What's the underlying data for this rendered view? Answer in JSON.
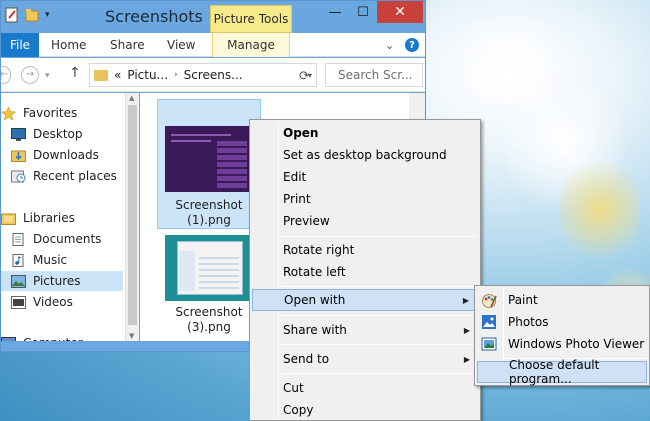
{
  "window": {
    "title": "Screenshots",
    "contextual_tab": "Picture Tools",
    "controls": {
      "minimize": "—",
      "maximize": "☐",
      "close": "✕"
    }
  },
  "ribbon": {
    "tabs": [
      "File",
      "Home",
      "Share",
      "View",
      "Manage"
    ],
    "expand_glyph": "⌄",
    "help_glyph": "?"
  },
  "address": {
    "back_glyph": "←",
    "forward_glyph": "→",
    "up_glyph": "↑",
    "dropdown_glyph": "▾",
    "prefix": "«",
    "segments": [
      "Pictu...",
      "Screens..."
    ],
    "separator": "›",
    "refresh_glyph": "⟳",
    "search_placeholder": "Search Scr..."
  },
  "nav_pane": {
    "items": [
      {
        "label": "Favorites",
        "icon": "star-icon"
      },
      {
        "label": "Desktop",
        "icon": "desktop-icon"
      },
      {
        "label": "Downloads",
        "icon": "downloads-icon"
      },
      {
        "label": "Recent places",
        "icon": "recent-places-icon"
      },
      {
        "label": "Libraries",
        "icon": "libraries-icon"
      },
      {
        "label": "Documents",
        "icon": "documents-icon"
      },
      {
        "label": "Music",
        "icon": "music-icon"
      },
      {
        "label": "Pictures",
        "icon": "pictures-icon",
        "selected": true
      },
      {
        "label": "Videos",
        "icon": "videos-icon"
      },
      {
        "label": "Computer",
        "icon": "computer-icon"
      }
    ]
  },
  "files": [
    {
      "name_line1": "Screenshot",
      "name_line2": "(1).png",
      "selected": true
    },
    {
      "name_line1": "Screenshot",
      "name_line2": "(3).png",
      "selected": false
    }
  ],
  "context_menu": {
    "items": [
      {
        "label": "Open",
        "bold": true
      },
      {
        "label": "Set as desktop background"
      },
      {
        "label": "Edit"
      },
      {
        "label": "Print"
      },
      {
        "label": "Preview"
      },
      {
        "label": "Rotate right"
      },
      {
        "label": "Rotate left"
      },
      {
        "label": "Open with",
        "submenu": true,
        "highlighted": true
      },
      {
        "label": "Share with",
        "submenu": true
      },
      {
        "label": "Send to",
        "submenu": true
      },
      {
        "label": "Cut"
      },
      {
        "label": "Copy"
      }
    ],
    "submenu_arrow": "▶"
  },
  "open_with_menu": {
    "items": [
      {
        "label": "Paint",
        "icon": "paint-icon"
      },
      {
        "label": "Photos",
        "icon": "photos-icon"
      },
      {
        "label": "Windows Photo Viewer",
        "icon": "photo-viewer-icon"
      },
      {
        "label": "Choose default program...",
        "highlighted": true
      }
    ]
  },
  "colors": {
    "title_bar": "#6aa6df",
    "file_tab": "#1979ca",
    "contextual_tab": "#f7ea8a",
    "selection": "#cce4f7",
    "close_button": "#c8413a",
    "menu_highlight": "#cfe1f5"
  }
}
